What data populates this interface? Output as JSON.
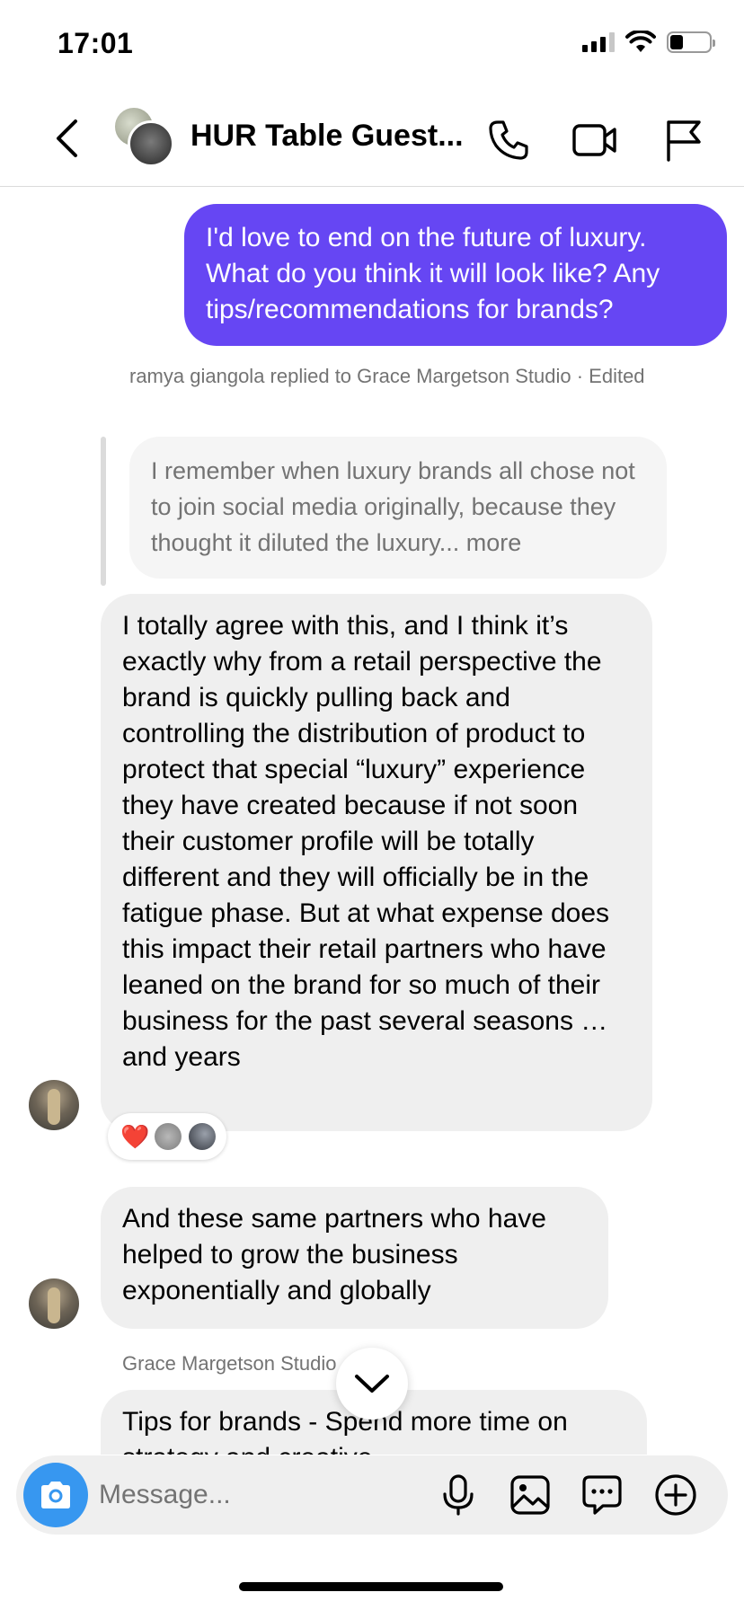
{
  "status_bar": {
    "time": "17:01"
  },
  "header": {
    "title": "HUR Table Guest...",
    "icons": [
      "back-icon",
      "phone-icon",
      "video-camera-icon",
      "flag-icon"
    ]
  },
  "thread": {
    "outgoing_message": "I'd love to end on the future of luxury. What do you think it will look like? Any tips/recommendations for brands?",
    "reply_meta": "ramya giangola replied to Grace Margetson Studio · Edited",
    "quoted_text": "I remember when luxury brands all chose not to join social media originally, because they thought it diluted the luxury... more",
    "message_1": "I totally agree with this, and I think it’s exactly why from a retail perspective the brand is quickly pulling back and controlling the distribution of product to protect that special “luxury” experience they have created because if not soon their customer profile will be totally different and they will officially be in the fatigue phase. But at what expense does this impact their retail partners who have leaned on the brand for so much of their business for the past several seasons … and years",
    "reaction_emoji": "❤️",
    "message_2": "And these same partners who have helped to grow the business exponentially and globally",
    "sender_name": "Grace Margetson Studio",
    "message_3": "Tips for brands - Spend more time on strategy and creative"
  },
  "composer": {
    "placeholder": "Message...",
    "icons": [
      "camera-icon",
      "microphone-icon",
      "gallery-icon",
      "sticker-icon",
      "plus-icon"
    ]
  },
  "colors": {
    "outgoing_bubble": "#6646f3",
    "incoming_bubble": "#efefef",
    "camera_button": "#3797f0",
    "reaction_heart": "#e0203b"
  }
}
